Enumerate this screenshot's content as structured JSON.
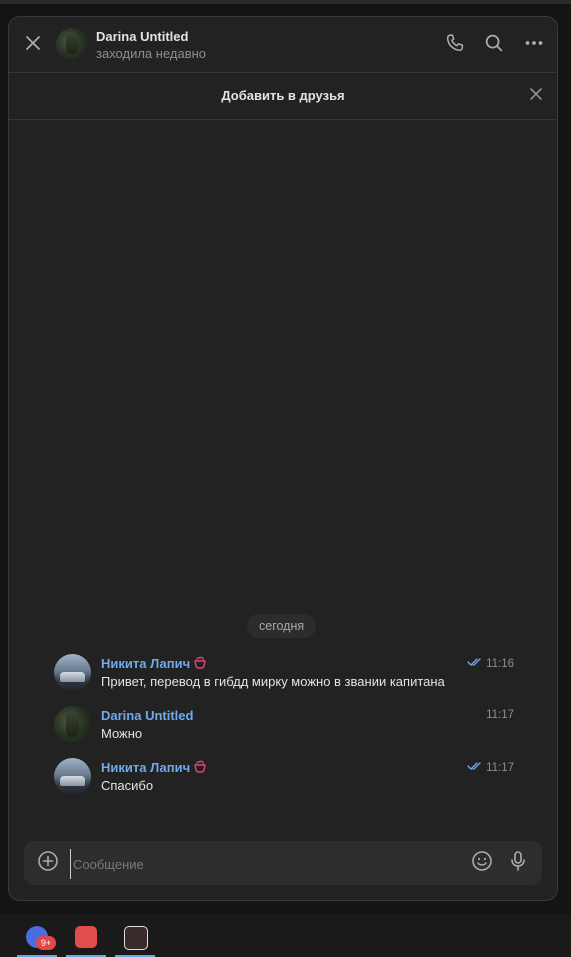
{
  "header": {
    "name": "Darina Untitled",
    "status": "заходила недавно"
  },
  "banner": {
    "title": "Добавить в друзья"
  },
  "date_divider": "сегодня",
  "messages": [
    {
      "author": "Никита Лапич",
      "text": "Привет, перевод в гибдд мирку можно в звании капитана",
      "time": "11:16",
      "read": true
    },
    {
      "author": "Darina Untitled",
      "text": "Можно",
      "time": "11:17",
      "read": false
    },
    {
      "author": "Никита Лапич",
      "text": "Спасибо",
      "time": "11:17",
      "read": true
    }
  ],
  "composer": {
    "placeholder": "Сообщение",
    "value": ""
  },
  "taskbar": {
    "items": [
      {
        "icon": "discord-app-icon",
        "badge": "9+"
      },
      {
        "icon": "cloud-app-icon"
      },
      {
        "icon": "cloud-dark-app-icon"
      }
    ]
  },
  "colors": {
    "background": "#222222",
    "accent": "#71aaeb",
    "badge": "#e64646"
  }
}
